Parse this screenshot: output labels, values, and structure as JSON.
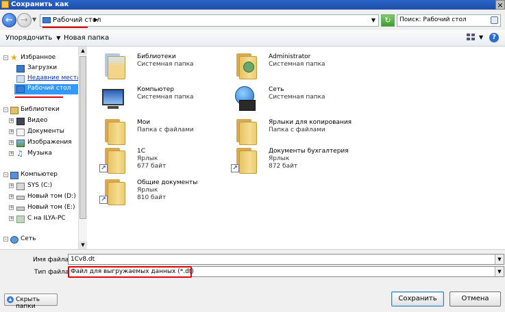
{
  "window": {
    "title": "Сохранить как",
    "close": "×"
  },
  "addressbar": {
    "location": "Рабочий стол",
    "search_placeholder": "Поиск: Рабочий стол"
  },
  "toolbar": {
    "organize": "Упорядочить",
    "new_folder": "Новая папка",
    "help": "?"
  },
  "nav": {
    "favorites": "Избранное",
    "downloads": "Загрузки",
    "recent": "Недавние места",
    "desktop": "Рабочий стол",
    "libraries": "Библиотеки",
    "video": "Видео",
    "documents": "Документы",
    "images": "Изображения",
    "music": "Музыка",
    "computer": "Компьютер",
    "drive_c": "SYS (C:)",
    "drive_d": "Новый том (D:)",
    "drive_e": "Новый том (E:)",
    "drive_ilya": "C на ILYA-PC",
    "network": "Сеть"
  },
  "items": [
    {
      "name": "Библиотеки",
      "type": "Системная папка"
    },
    {
      "name": "Administrator",
      "type": "Системная папка"
    },
    {
      "name": "Компьютер",
      "type": "Системная папка"
    },
    {
      "name": "Сеть",
      "type": "Системная папка"
    },
    {
      "name": "Мои",
      "type": "Папка с файлами"
    },
    {
      "name": "Ярлыки для копирования",
      "type": "Папка с файлами"
    },
    {
      "name": "1С",
      "type": "Ярлык",
      "size": "677 байт"
    },
    {
      "name": "Документы бухгалтерия",
      "type": "Ярлык",
      "size": "872 байт"
    },
    {
      "name": "Общие документы",
      "type": "Ярлык",
      "size": "810 байт"
    }
  ],
  "form": {
    "filename_label": "Имя файла:",
    "filename_value": "1Cv8.dt",
    "filetype_label": "Тип файла:",
    "filetype_value": "Файл для выгружаемых данных (*.dt)"
  },
  "buttons": {
    "hide_folders": "Скрыть папки",
    "save": "Сохранить",
    "cancel": "Отмена"
  },
  "colors": {
    "highlight": "#e00000",
    "selection": "#3399ff",
    "titlebar": "#2a64c8"
  }
}
